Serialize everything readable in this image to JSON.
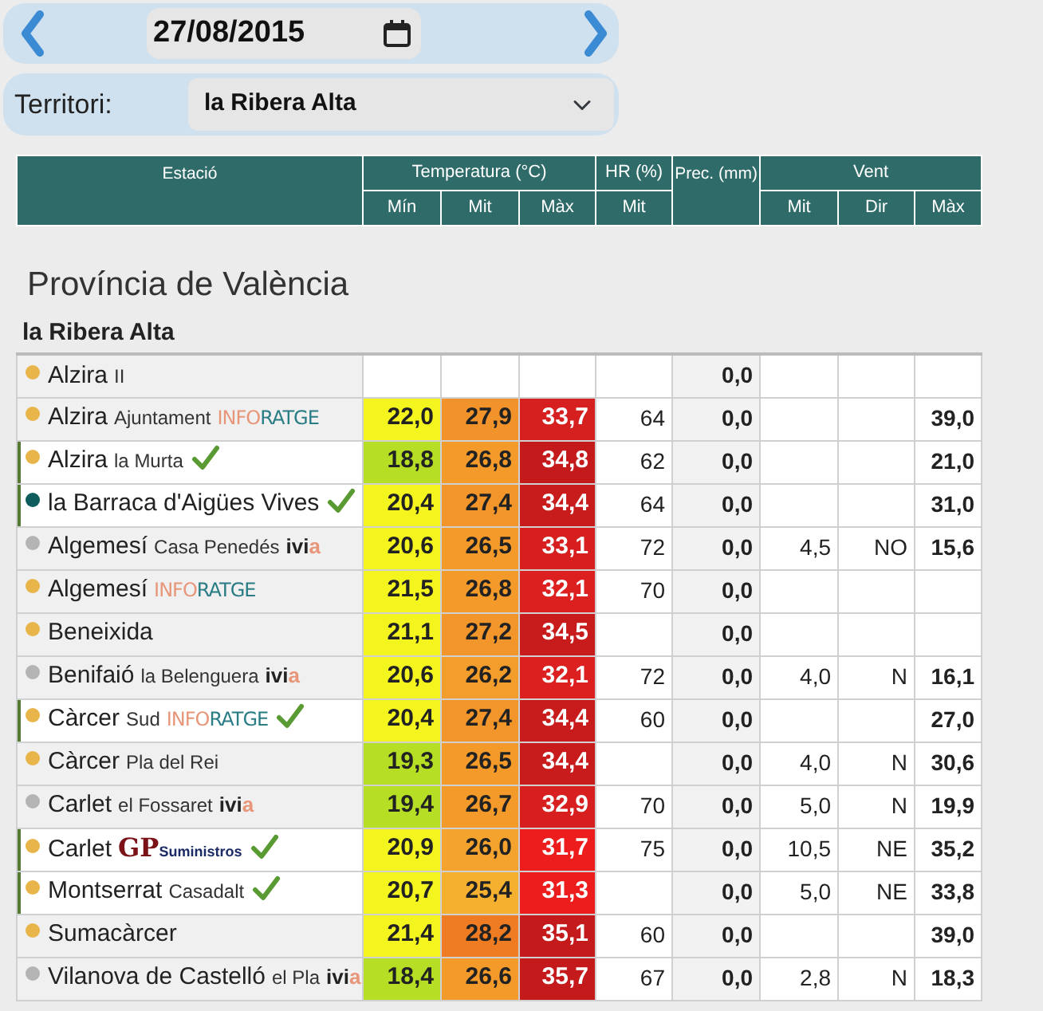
{
  "date_nav": {
    "date": "27/08/2015"
  },
  "territory": {
    "label": "Territori:",
    "value": "la Ribera Alta"
  },
  "header": [
    {
      "label": "Estació"
    },
    {
      "label": "Temperatura (°C)",
      "sub": [
        "Mín",
        "Mit",
        "Màx"
      ]
    },
    {
      "label": "HR (%)",
      "sub": [
        "Mit"
      ]
    },
    {
      "label": "Prec. (mm)"
    },
    {
      "label": "Vent",
      "sub": [
        "Mit",
        "Dir",
        "Màx"
      ]
    }
  ],
  "province": "Província de València",
  "region": "la Ribera Alta",
  "rows": [
    {
      "name": "Alzira",
      "detail": "II",
      "color": "#e8b54a",
      "verified": false,
      "prec": "0,0"
    },
    {
      "name": "Alzira",
      "detail": "Ajuntament",
      "brand": {
        "kind": "inforatge",
        "parts": [
          "INFO",
          "RATGE"
        ]
      },
      "color": "#e8b54a",
      "verified": false,
      "min": {
        "value": "22,0",
        "color": "#f4f41e"
      },
      "mit": {
        "value": "27,9",
        "color": "#f2922a"
      },
      "max": {
        "value": "33,7",
        "color": "#d61f1f"
      },
      "hr": "64",
      "prec": "0,0",
      "wind_max": "39,0"
    },
    {
      "name": "Alzira",
      "detail": "la Murta",
      "color": "#e8b54a",
      "verified": true,
      "min": {
        "value": "18,8",
        "color": "#b6de24"
      },
      "mit": {
        "value": "26,8",
        "color": "#f39a2b"
      },
      "max": {
        "value": "34,8",
        "color": "#c41a1b"
      },
      "hr": "62",
      "prec": "0,0",
      "wind_max": "21,0"
    },
    {
      "name": "la Barraca d'Aigües Vives",
      "color": "#0e5c5c",
      "verified": true,
      "min": {
        "value": "20,4",
        "color": "#f4f41e"
      },
      "mit": {
        "value": "27,4",
        "color": "#f2952a"
      },
      "max": {
        "value": "34,4",
        "color": "#c81b1b"
      },
      "hr": "64",
      "prec": "0,0",
      "wind_max": "31,0"
    },
    {
      "name": "Algemesí",
      "detail": "Casa Penedés",
      "brand": {
        "kind": "ivia",
        "parts": [
          "ivi",
          "a"
        ]
      },
      "color": "#b4b4b4",
      "verified": false,
      "min": {
        "value": "20,6",
        "color": "#f4f41e"
      },
      "mit": {
        "value": "26,5",
        "color": "#f39a2b"
      },
      "max": {
        "value": "33,1",
        "color": "#d81f1f"
      },
      "hr": "72",
      "prec": "0,0",
      "wind_mit": "4,5",
      "wind_dir": "NO",
      "wind_max": "15,6"
    },
    {
      "name": "Algemesí",
      "brand": {
        "kind": "inforatge",
        "parts": [
          "INFO",
          "RATGE"
        ]
      },
      "color": "#e8b54a",
      "verified": false,
      "min": {
        "value": "21,5",
        "color": "#f4f41e"
      },
      "mit": {
        "value": "26,8",
        "color": "#f39a2b"
      },
      "max": {
        "value": "32,1",
        "color": "#dc1f1f"
      },
      "hr": "70",
      "prec": "0,0"
    },
    {
      "name": "Beneixida",
      "color": "#e8b54a",
      "verified": false,
      "min": {
        "value": "21,1",
        "color": "#f4f41e"
      },
      "mit": {
        "value": "27,2",
        "color": "#f2952a"
      },
      "max": {
        "value": "34,5",
        "color": "#c81b1b"
      },
      "prec": "0,0"
    },
    {
      "name": "Benifaió",
      "detail": "la Belenguera",
      "brand": {
        "kind": "ivia",
        "parts": [
          "ivi",
          "a"
        ]
      },
      "color": "#b4b4b4",
      "verified": false,
      "min": {
        "value": "20,6",
        "color": "#f4f41e"
      },
      "mit": {
        "value": "26,2",
        "color": "#f39d2c"
      },
      "max": {
        "value": "32,1",
        "color": "#dc1f1f"
      },
      "hr": "72",
      "prec": "0,0",
      "wind_mit": "4,0",
      "wind_dir": "N",
      "wind_max": "16,1"
    },
    {
      "name": "Càrcer",
      "detail": "Sud",
      "brand": {
        "kind": "inforatge",
        "parts": [
          "INFO",
          "RATGE"
        ]
      },
      "color": "#e8b54a",
      "verified": true,
      "min": {
        "value": "20,4",
        "color": "#f4f41e"
      },
      "mit": {
        "value": "27,4",
        "color": "#f2952a"
      },
      "max": {
        "value": "34,4",
        "color": "#c81b1b"
      },
      "hr": "60",
      "prec": "0,0",
      "wind_max": "27,0"
    },
    {
      "name": "Càrcer",
      "detail": "Pla del Rei",
      "color": "#e8b54a",
      "verified": false,
      "min": {
        "value": "19,3",
        "color": "#b6de24"
      },
      "mit": {
        "value": "26,5",
        "color": "#f39a2b"
      },
      "max": {
        "value": "34,4",
        "color": "#c81b1b"
      },
      "prec": "0,0",
      "wind_mit": "4,0",
      "wind_dir": "N",
      "wind_max": "30,6"
    },
    {
      "name": "Carlet",
      "detail": "el Fossaret",
      "brand": {
        "kind": "ivia",
        "parts": [
          "ivi",
          "a"
        ]
      },
      "color": "#b4b4b4",
      "verified": false,
      "min": {
        "value": "19,4",
        "color": "#b6de24"
      },
      "mit": {
        "value": "26,7",
        "color": "#f39a2b"
      },
      "max": {
        "value": "32,9",
        "color": "#d81f1f"
      },
      "hr": "70",
      "prec": "0,0",
      "wind_mit": "5,0",
      "wind_dir": "N",
      "wind_max": "19,9"
    },
    {
      "name": "Carlet",
      "brand": {
        "kind": "gp",
        "parts": [
          "GP",
          "Suministros"
        ]
      },
      "color": "#e8b54a",
      "verified": true,
      "min": {
        "value": "20,9",
        "color": "#f4f41e"
      },
      "mit": {
        "value": "26,0",
        "color": "#f4a42e"
      },
      "max": {
        "value": "31,7",
        "color": "#ee1d1d"
      },
      "hr": "75",
      "prec": "0,0",
      "wind_mit": "10,5",
      "wind_dir": "NE",
      "wind_max": "35,2"
    },
    {
      "name": "Montserrat",
      "detail": "Casadalt",
      "color": "#e8b54a",
      "verified": true,
      "min": {
        "value": "20,7",
        "color": "#f4f41e"
      },
      "mit": {
        "value": "25,4",
        "color": "#f6b030"
      },
      "max": {
        "value": "31,3",
        "color": "#ee1d1d"
      },
      "prec": "0,0",
      "wind_mit": "5,0",
      "wind_dir": "NE",
      "wind_max": "33,8"
    },
    {
      "name": "Sumacàrcer",
      "color": "#e8b54a",
      "verified": false,
      "min": {
        "value": "21,4",
        "color": "#f4f41e"
      },
      "mit": {
        "value": "28,2",
        "color": "#ef7c22"
      },
      "max": {
        "value": "35,1",
        "color": "#c41a1b"
      },
      "hr": "60",
      "prec": "0,0",
      "wind_max": "39,0"
    },
    {
      "name": "Vilanova de Castelló",
      "detail": "el Pla",
      "brand": {
        "kind": "ivia",
        "parts": [
          "ivi",
          "a"
        ]
      },
      "color": "#b4b4b4",
      "verified": false,
      "min": {
        "value": "18,4",
        "color": "#b6de24"
      },
      "mit": {
        "value": "26,6",
        "color": "#f39a2b"
      },
      "max": {
        "value": "35,7",
        "color": "#c41a1b"
      },
      "hr": "67",
      "prec": "0,0",
      "wind_mit": "2,8",
      "wind_dir": "N",
      "wind_max": "18,3"
    }
  ]
}
